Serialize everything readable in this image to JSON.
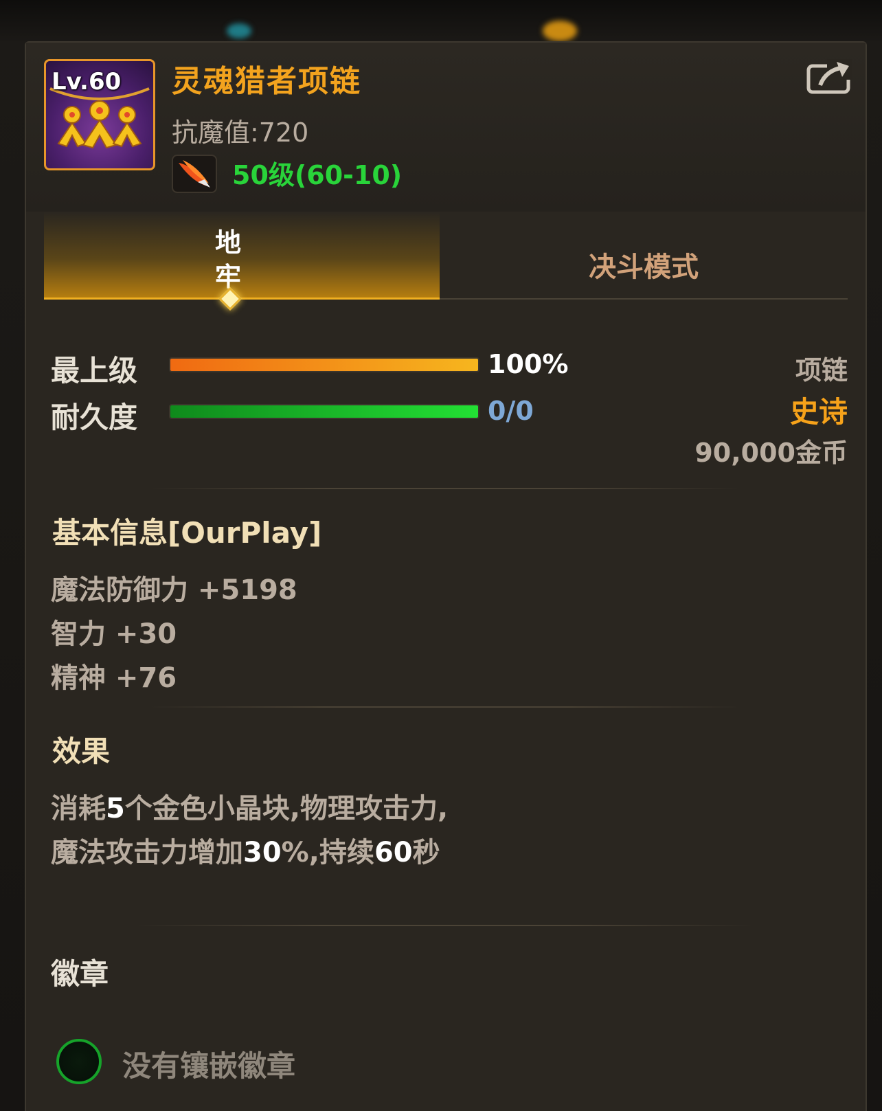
{
  "item": {
    "level_badge": "Lv.60",
    "name": "灵魂猎者项链",
    "magic_resist": "抗魔值:720",
    "level_range": "50级(60-10)",
    "type": "项链",
    "rarity": "史诗",
    "price": "90,000金币"
  },
  "tabs": [
    {
      "label": "地牢",
      "active": true
    },
    {
      "label": "决斗模式",
      "active": false
    }
  ],
  "stats": {
    "upgrade": {
      "label": "最上级",
      "value": "100%",
      "fill_percent": 100
    },
    "durability": {
      "label": "耐久度",
      "value": "0/0",
      "fill_percent": 100
    }
  },
  "basic_info": {
    "title": "基本信息[OurPlay]",
    "attributes": [
      "魔法防御力 +5198",
      "智力 +30",
      "精神 +76"
    ]
  },
  "effect": {
    "title": "效果",
    "line1": {
      "a": "消耗",
      "b": "5",
      "c": "个金色小晶块,物理攻击力,"
    },
    "line2": {
      "a": "魔法攻击力增加",
      "b": "30",
      "c": "%,持续",
      "d": "60",
      "e": "秒"
    }
  },
  "badge": {
    "title": "徽章",
    "empty_text": "没有镶嵌徽章"
  },
  "icons": {
    "share": "share-icon",
    "item": "necklace-icon",
    "level": "phoenix-wing-icon"
  },
  "colors": {
    "accent_gold": "#f3a31e",
    "level_green": "#29d43a",
    "epic_orange": "#f6a21a",
    "durability_blue": "#7ea8d6"
  }
}
